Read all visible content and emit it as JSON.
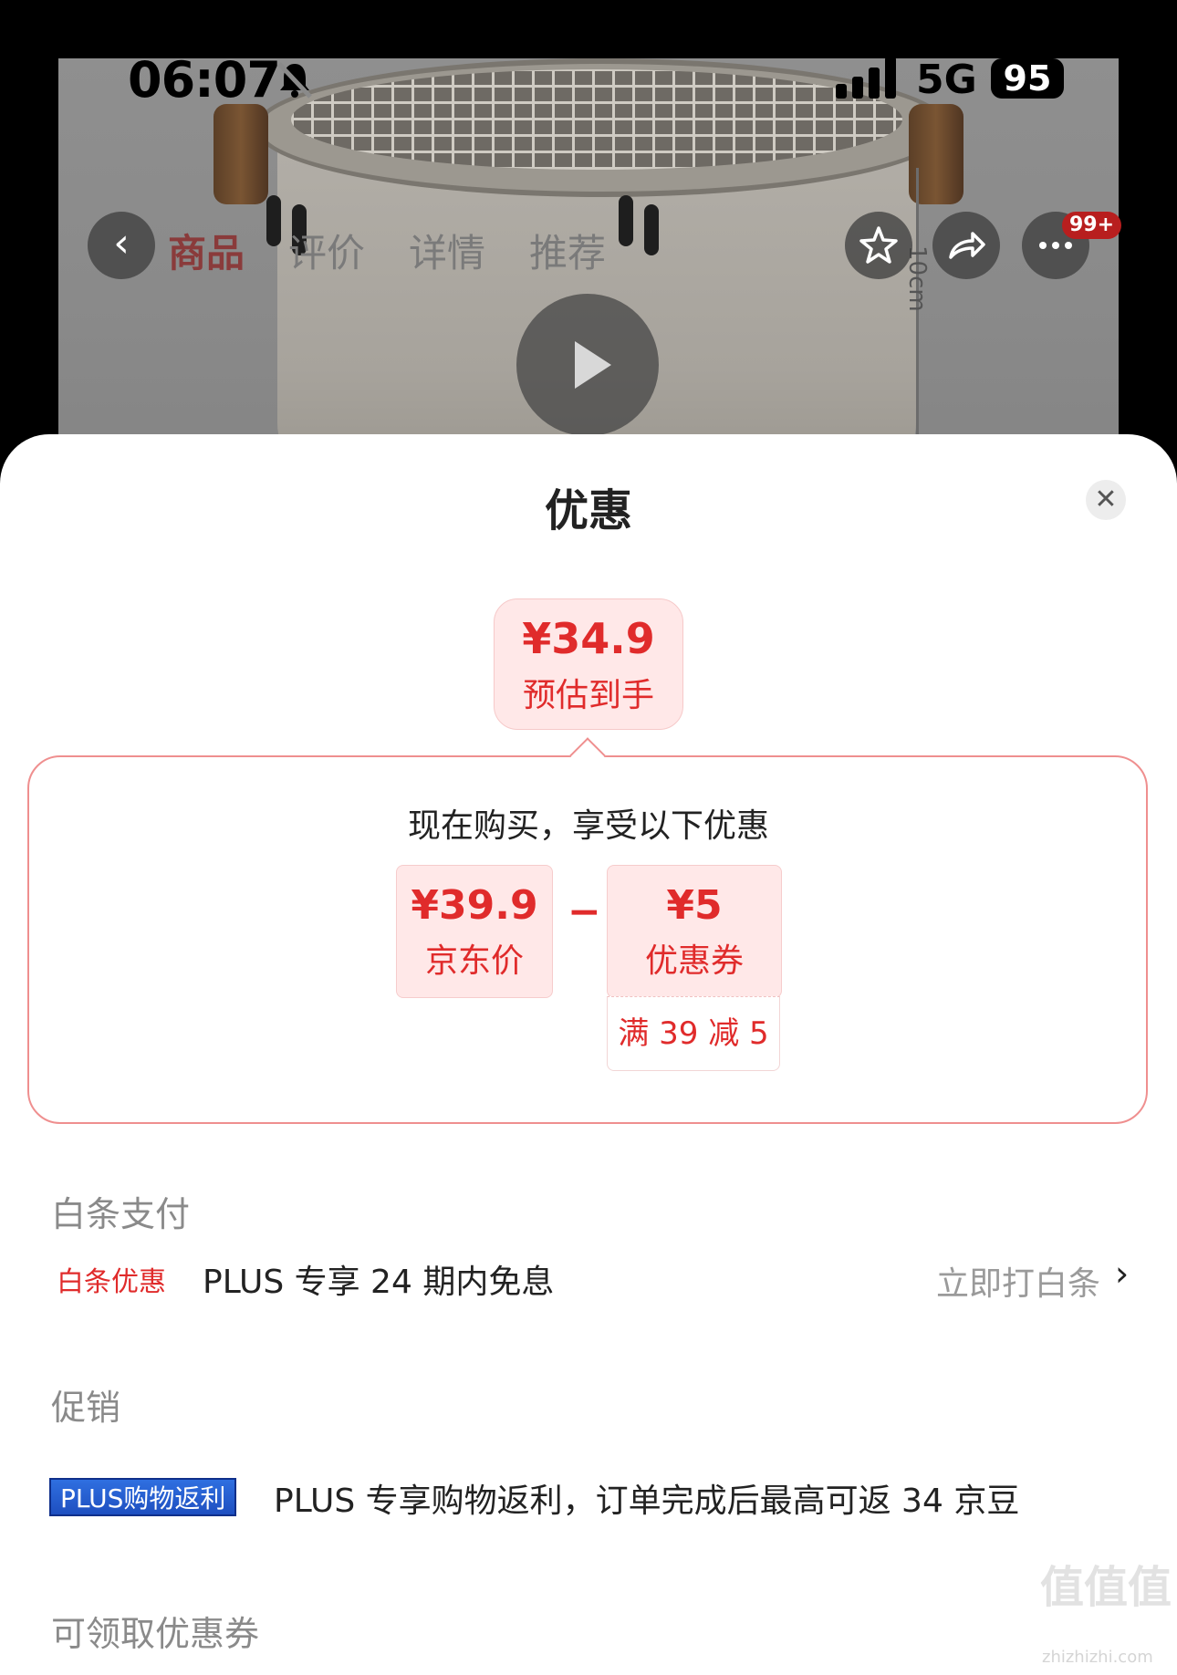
{
  "status_bar": {
    "time": "06:07",
    "network": "5G",
    "battery": "95"
  },
  "product": {
    "measure_label": "10cm"
  },
  "nav": {
    "tabs": [
      "商品",
      "评价",
      "详情",
      "推荐"
    ],
    "active_tab": "商品",
    "badge": "99+"
  },
  "sheet": {
    "title": "优惠",
    "estimate": {
      "price": "¥34.9",
      "label": "预估到手"
    },
    "offer": {
      "heading": "现在购买，享受以下优惠",
      "jd_price": "¥39.9",
      "jd_label": "京东价",
      "minus": "−",
      "coupon_amount": "¥5",
      "coupon_label": "优惠券",
      "coupon_condition": "满 39 减 5"
    },
    "baitiao": {
      "section_title": "白条支付",
      "tag": "白条优惠",
      "text": "PLUS 专享 24 期内免息",
      "action": "立即打白条"
    },
    "promo": {
      "section_title": "促销",
      "tag": "PLUS购物返利",
      "text": "PLUS 专享购物返利，订单完成后最高可返 34 京豆"
    },
    "coupons": {
      "section_title": "可领取优惠券"
    }
  },
  "watermark": {
    "logo": "值值值",
    "url": "zhizhizhi.com"
  },
  "colors": {
    "accent_red": "#e02b2b",
    "plus_blue": "#1e4fc0"
  }
}
